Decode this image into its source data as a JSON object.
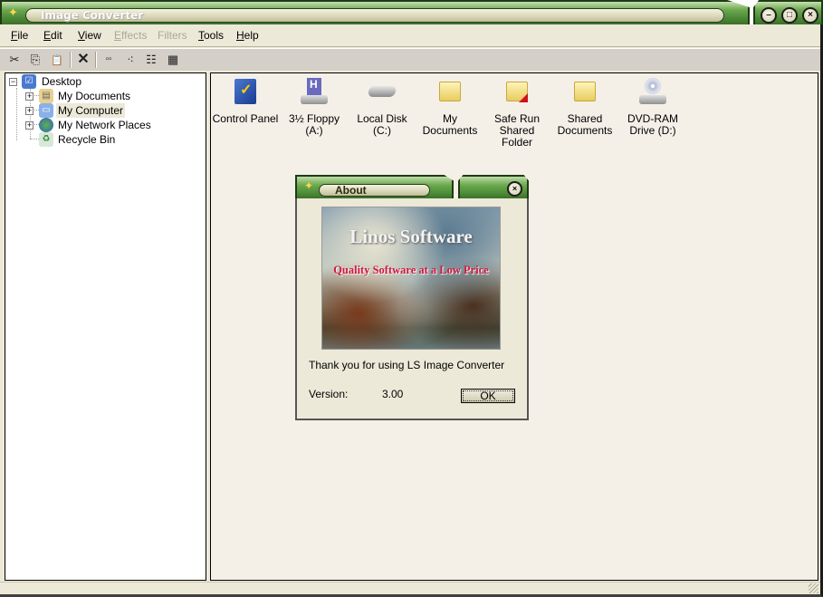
{
  "window": {
    "title": "Image Converter",
    "controls": {
      "minimize": "–",
      "maximize": "□",
      "close": "×"
    }
  },
  "menu": [
    {
      "label": "File",
      "underline": "F",
      "rest": "ile",
      "enabled": true
    },
    {
      "label": "Edit",
      "underline": "E",
      "rest": "dit",
      "enabled": true
    },
    {
      "label": "View",
      "underline": "V",
      "rest": "iew",
      "enabled": true
    },
    {
      "label": "Effects",
      "underline": "E",
      "rest": "ffects",
      "enabled": false
    },
    {
      "label": "Filters",
      "underline": "",
      "rest": "Filters",
      "enabled": false
    },
    {
      "label": "Tools",
      "underline": "T",
      "rest": "ools",
      "enabled": true
    },
    {
      "label": "Help",
      "underline": "H",
      "rest": "elp",
      "enabled": true
    }
  ],
  "toolbar": [
    {
      "name": "cut",
      "icon": "scissors-icon",
      "glyph": "✂"
    },
    {
      "name": "copy",
      "icon": "copy-icon",
      "glyph": "⎘"
    },
    {
      "name": "paste",
      "icon": "paste-icon",
      "glyph": "📋"
    },
    {
      "name": "delete",
      "icon": "delete-icon",
      "glyph": "✕"
    },
    {
      "name": "large-icons",
      "icon": "large-icons-view-icon",
      "glyph": "▫▫"
    },
    {
      "name": "small-icons",
      "icon": "small-icons-view-icon",
      "glyph": "⁖"
    },
    {
      "name": "list",
      "icon": "list-view-icon",
      "glyph": "☷"
    },
    {
      "name": "details",
      "icon": "details-view-icon",
      "glyph": "▦"
    }
  ],
  "tree": {
    "root": {
      "label": "Desktop",
      "icon": "desktop-icon",
      "expanded": true
    },
    "children": [
      {
        "label": "My Documents",
        "icon": "my-documents-icon",
        "expandable": true,
        "selected": false
      },
      {
        "label": "My Computer",
        "icon": "my-computer-icon",
        "expandable": true,
        "selected": true
      },
      {
        "label": "My Network Places",
        "icon": "network-places-icon",
        "expandable": true,
        "selected": false
      },
      {
        "label": "Recycle Bin",
        "icon": "recycle-bin-icon",
        "expandable": false,
        "selected": false
      }
    ]
  },
  "files": [
    {
      "line1": "Control Panel",
      "line2": "",
      "icon": "control-panel-icon"
    },
    {
      "line1": "3½ Floppy (A:)",
      "line2": "",
      "icon": "floppy-drive-icon"
    },
    {
      "line1": "Local Disk (C:)",
      "line2": "",
      "icon": "hard-disk-icon"
    },
    {
      "line1": "My Documents",
      "line2": "",
      "icon": "folder-icon"
    },
    {
      "line1": "Safe Run",
      "line2": "Shared Folder",
      "icon": "shared-folder-icon"
    },
    {
      "line1": "Shared",
      "line2": "Documents",
      "icon": "folder-icon"
    },
    {
      "line1": "DVD-RAM",
      "line2": "Drive (D:)",
      "icon": "dvd-drive-icon"
    }
  ],
  "about": {
    "title": "About",
    "banner_title": "Linos Software",
    "banner_subtitle": "Quality Software at a Low Price",
    "thanks": "Thank you for using LS Image Converter",
    "version_label": "Version:",
    "version_value": "3.00",
    "ok_label": "OK",
    "close": "×"
  },
  "colors": {
    "titlebar_green": "#4c8a38",
    "window_bg": "#ece9d8",
    "content_bg": "#f4f0e8",
    "banner_subtitle": "#d01840"
  }
}
